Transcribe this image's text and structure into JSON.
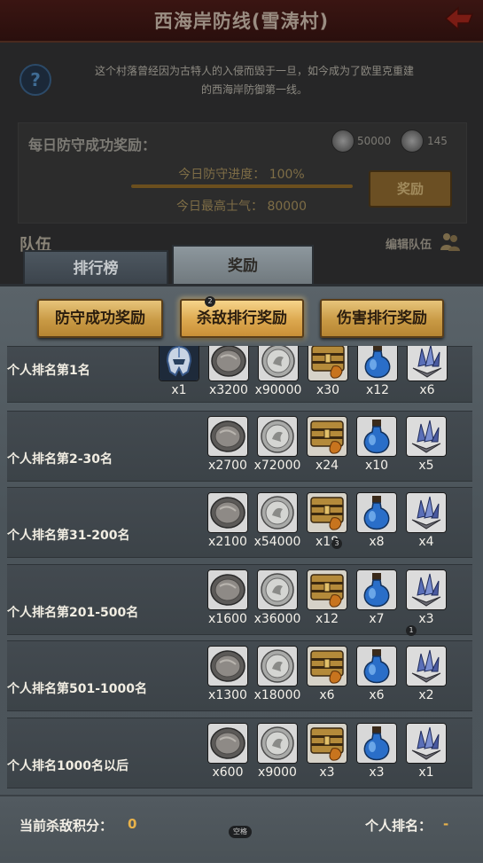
{
  "background": {
    "title": "西海岸防线(雪涛村)",
    "description_line1": "这个村落曾经因为古特人的入侵而毁于一旦，如今成为了欧里克重建",
    "description_line2": "的西海岸防御第一线。",
    "daily_reward_label": "每日防守成功奖励：",
    "coin_1_value": "50000",
    "coin_2_value": "145",
    "progress_label": "今日防守进度：  100%",
    "progress_fraction": 1.0,
    "morale_label": "今日最高士气：  80000",
    "reward_button": "奖励",
    "team_label": "队伍",
    "edit_team_label": "编辑队伍"
  },
  "tabs": {
    "ranking": "排行榜",
    "reward": "奖励"
  },
  "sub_tabs": [
    {
      "label": "防守成功奖励",
      "active": false
    },
    {
      "label": "杀敌排行奖励",
      "active": true,
      "badge": "2"
    },
    {
      "label": "伤害排行奖励",
      "active": false
    }
  ],
  "rows": [
    {
      "label": "个人排名第1名",
      "items": [
        {
          "icon": "helmet-icon",
          "qty": "x1"
        },
        {
          "icon": "iron-coin-icon",
          "qty": "x3200"
        },
        {
          "icon": "silver-coin-icon",
          "qty": "x90000"
        },
        {
          "icon": "treasure-chest-icon",
          "qty": "x30"
        },
        {
          "icon": "potion-icon",
          "qty": "x12"
        },
        {
          "icon": "crystal-icon",
          "qty": "x6"
        }
      ]
    },
    {
      "label": "个人排名第2-30名",
      "items": [
        {
          "icon": "iron-coin-icon",
          "qty": "x2700"
        },
        {
          "icon": "silver-coin-icon",
          "qty": "x72000"
        },
        {
          "icon": "treasure-chest-icon",
          "qty": "x24"
        },
        {
          "icon": "potion-icon",
          "qty": "x10"
        },
        {
          "icon": "crystal-icon",
          "qty": "x5"
        }
      ]
    },
    {
      "label": "个人排名第31-200名",
      "items": [
        {
          "icon": "iron-coin-icon",
          "qty": "x2100"
        },
        {
          "icon": "silver-coin-icon",
          "qty": "x54000"
        },
        {
          "icon": "treasure-chest-icon",
          "qty": "x18"
        },
        {
          "icon": "potion-icon",
          "qty": "x8"
        },
        {
          "icon": "crystal-icon",
          "qty": "x4"
        }
      ]
    },
    {
      "label": "个人排名第201-500名",
      "items": [
        {
          "icon": "iron-coin-icon",
          "qty": "x1600"
        },
        {
          "icon": "silver-coin-icon",
          "qty": "x36000"
        },
        {
          "icon": "treasure-chest-icon",
          "qty": "x12"
        },
        {
          "icon": "potion-icon",
          "qty": "x7"
        },
        {
          "icon": "crystal-icon",
          "qty": "x3"
        }
      ]
    },
    {
      "label": "个人排名第501-1000名",
      "items": [
        {
          "icon": "iron-coin-icon",
          "qty": "x1300"
        },
        {
          "icon": "silver-coin-icon",
          "qty": "x18000"
        },
        {
          "icon": "treasure-chest-icon",
          "qty": "x6"
        },
        {
          "icon": "potion-icon",
          "qty": "x6"
        },
        {
          "icon": "crystal-icon",
          "qty": "x2"
        }
      ]
    },
    {
      "label": "个人排名1000名以后",
      "items": [
        {
          "icon": "iron-coin-icon",
          "qty": "x600"
        },
        {
          "icon": "silver-coin-icon",
          "qty": "x9000"
        },
        {
          "icon": "treasure-chest-icon",
          "qty": "x3"
        },
        {
          "icon": "potion-icon",
          "qty": "x3"
        },
        {
          "icon": "crystal-icon",
          "qty": "x1"
        }
      ]
    }
  ],
  "overlay_badges": [
    "3",
    "1"
  ],
  "footer": {
    "kill_points_label": "当前杀敌积分：",
    "kill_points_value": "0",
    "rank_label": "个人排名：",
    "rank_value": "-",
    "space_key_label": "空格"
  },
  "colors": {
    "accent_gold": "#e8b24a",
    "button_gold": "#d9a54c",
    "panel_slate": "#4b545a"
  }
}
